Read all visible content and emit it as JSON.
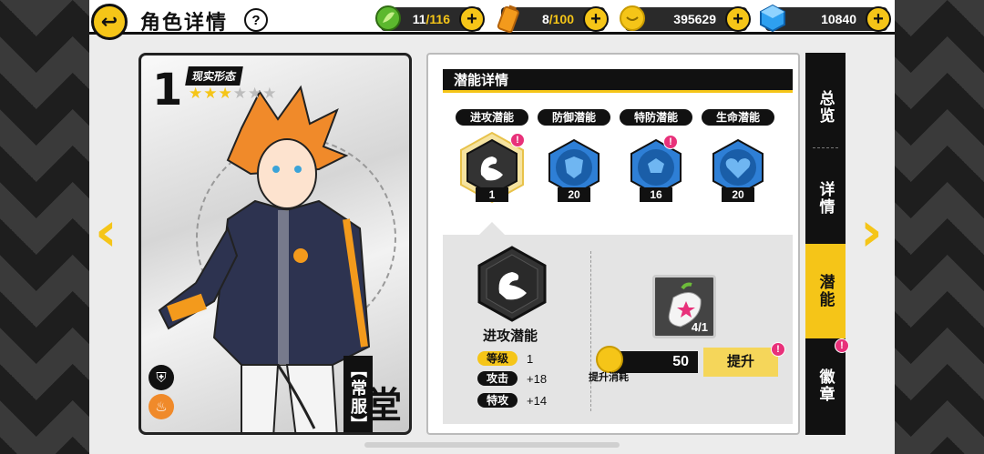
{
  "header": {
    "title": "角色详情",
    "help": "?"
  },
  "resources": {
    "stamina": {
      "current": "11",
      "max": "116",
      "icon": "leaf-energy-icon"
    },
    "battery": {
      "current": "8",
      "max": "100",
      "icon": "battery-icon"
    },
    "coins": {
      "value": "395629",
      "icon": "coin-icon"
    },
    "gems": {
      "value": "10840",
      "icon": "blue-gem-icon"
    },
    "plus": "+"
  },
  "card": {
    "rank": "1",
    "form_label": "现实形态",
    "stars_on": 3,
    "stars_off": 3,
    "outfit": "【常服】",
    "name": "堂"
  },
  "detail": {
    "header": "潜能详情",
    "tabs": [
      {
        "label": "进攻潜能",
        "level": "1",
        "icon": "bicep-icon",
        "selected": true,
        "alert": true
      },
      {
        "label": "防御潜能",
        "level": "20",
        "icon": "shield-icon",
        "selected": false,
        "alert": false
      },
      {
        "label": "特防潜能",
        "level": "16",
        "icon": "soccer-ball-icon",
        "selected": false,
        "alert": true
      },
      {
        "label": "生命潜能",
        "level": "20",
        "icon": "heart-icon",
        "selected": false,
        "alert": false
      }
    ],
    "selected": {
      "name": "进攻潜能",
      "stats": [
        {
          "label": "等级",
          "value": "1"
        },
        {
          "label": "攻击",
          "value": "+18"
        },
        {
          "label": "特攻",
          "value": "+14"
        }
      ]
    },
    "item_count": "4/1",
    "cost": "50",
    "cost_label": "提升消耗",
    "upgrade": "提升",
    "alert_mark": "!"
  },
  "side_tabs": [
    {
      "label": "总览",
      "active": false
    },
    {
      "label": "详情",
      "active": false
    },
    {
      "label": "潜能",
      "active": true
    },
    {
      "label": "徽章",
      "active": false
    }
  ],
  "colors": {
    "accent": "#f5c518",
    "hex_blue": "#2e7fd6",
    "alert": "#e8317a"
  }
}
